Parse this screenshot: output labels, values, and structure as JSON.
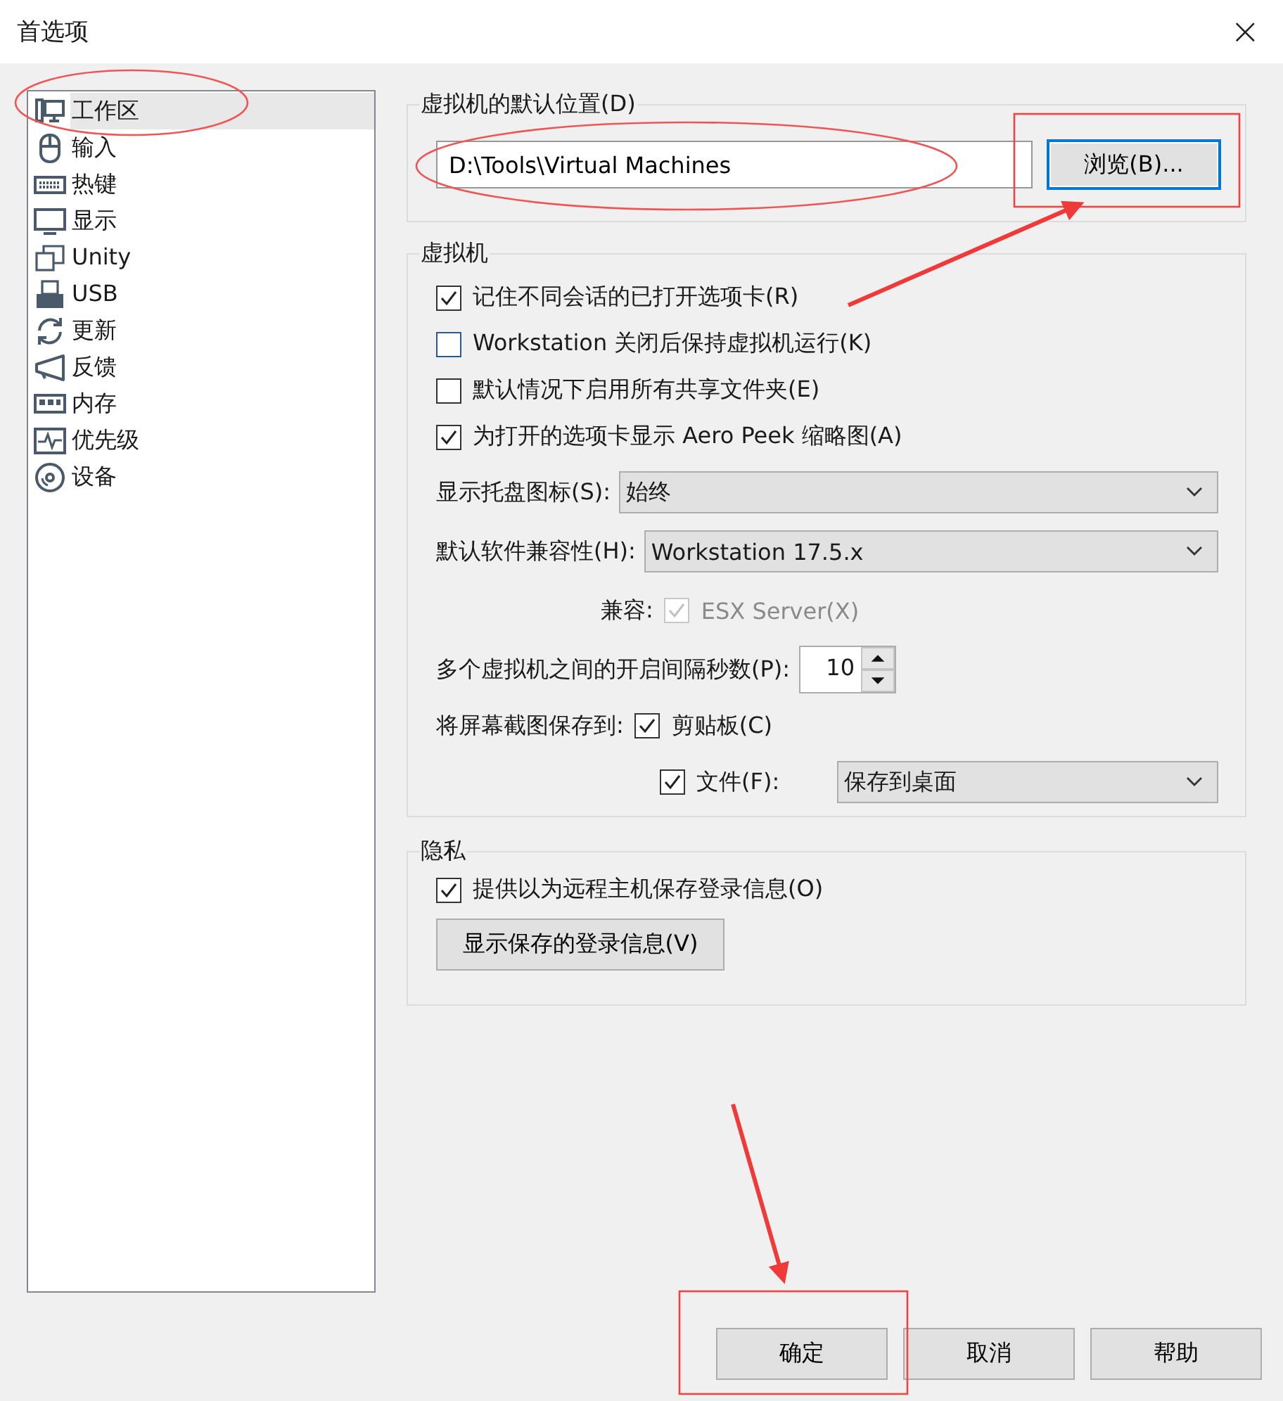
{
  "window": {
    "title": "首选项",
    "close": "×"
  },
  "sidebar": {
    "items": [
      {
        "label": "工作区",
        "kind": "workspace",
        "selected": true
      },
      {
        "label": "输入",
        "kind": "mouse",
        "selected": false
      },
      {
        "label": "热键",
        "kind": "keyboard",
        "selected": false
      },
      {
        "label": "显示",
        "kind": "monitor",
        "selected": false
      },
      {
        "label": "Unity",
        "kind": "windows",
        "selected": false
      },
      {
        "label": "USB",
        "kind": "usb",
        "selected": false
      },
      {
        "label": "更新",
        "kind": "refresh",
        "selected": false
      },
      {
        "label": "反馈",
        "kind": "megaphone",
        "selected": false
      },
      {
        "label": "内存",
        "kind": "memory",
        "selected": false
      },
      {
        "label": "优先级",
        "kind": "pulse",
        "selected": false
      },
      {
        "label": "设备",
        "kind": "disc",
        "selected": false
      }
    ]
  },
  "default_location": {
    "title": "虚拟机的默认位置(D)",
    "path": "D:\\Tools\\Virtual Machines",
    "browse_button": "浏览(B)..."
  },
  "virtual_machine": {
    "title": "虚拟机",
    "options": [
      {
        "label": "记住不同会话的已打开选项卡(R)",
        "checked": true
      },
      {
        "label": "Workstation 关闭后保持虚拟机运行(K)",
        "checked": false
      },
      {
        "label": "默认情况下启用所有共享文件夹(E)",
        "checked": false
      },
      {
        "label": "为打开的选项卡显示 Aero Peek 缩略图(A)",
        "checked": true
      }
    ],
    "tray_icon": {
      "label": "显示托盘图标(S):",
      "value": "始终"
    },
    "compatibility": {
      "label": "默认软件兼容性(H):",
      "value": "Workstation 17.5.x"
    },
    "compatible_with": {
      "label": "兼容:",
      "option": "ESX Server(X)",
      "checked": true,
      "disabled": true
    },
    "startup_delay": {
      "label": "多个虚拟机之间的开启间隔秒数(P):",
      "value": "10"
    },
    "screenshot": {
      "label": "将屏幕截图保存到:",
      "clipboard": {
        "label": "剪贴板(C)",
        "checked": true
      },
      "file": {
        "label": "文件(F):",
        "checked": true,
        "value": "保存到桌面"
      }
    }
  },
  "privacy": {
    "title": "隐私",
    "options": [
      {
        "label": "提供以为远程主机保存登录信息(O)",
        "checked": true
      }
    ],
    "button": "显示保存的登录信息(V)"
  },
  "buttons": [
    "确定",
    "取消",
    "帮助"
  ],
  "annotations": [
    {
      "kind": "ellipse"
    },
    {
      "kind": "ellipse"
    },
    {
      "kind": "rectangle"
    },
    {
      "kind": "arrow"
    },
    {
      "kind": "arrow"
    },
    {
      "kind": "rectangle"
    }
  ]
}
